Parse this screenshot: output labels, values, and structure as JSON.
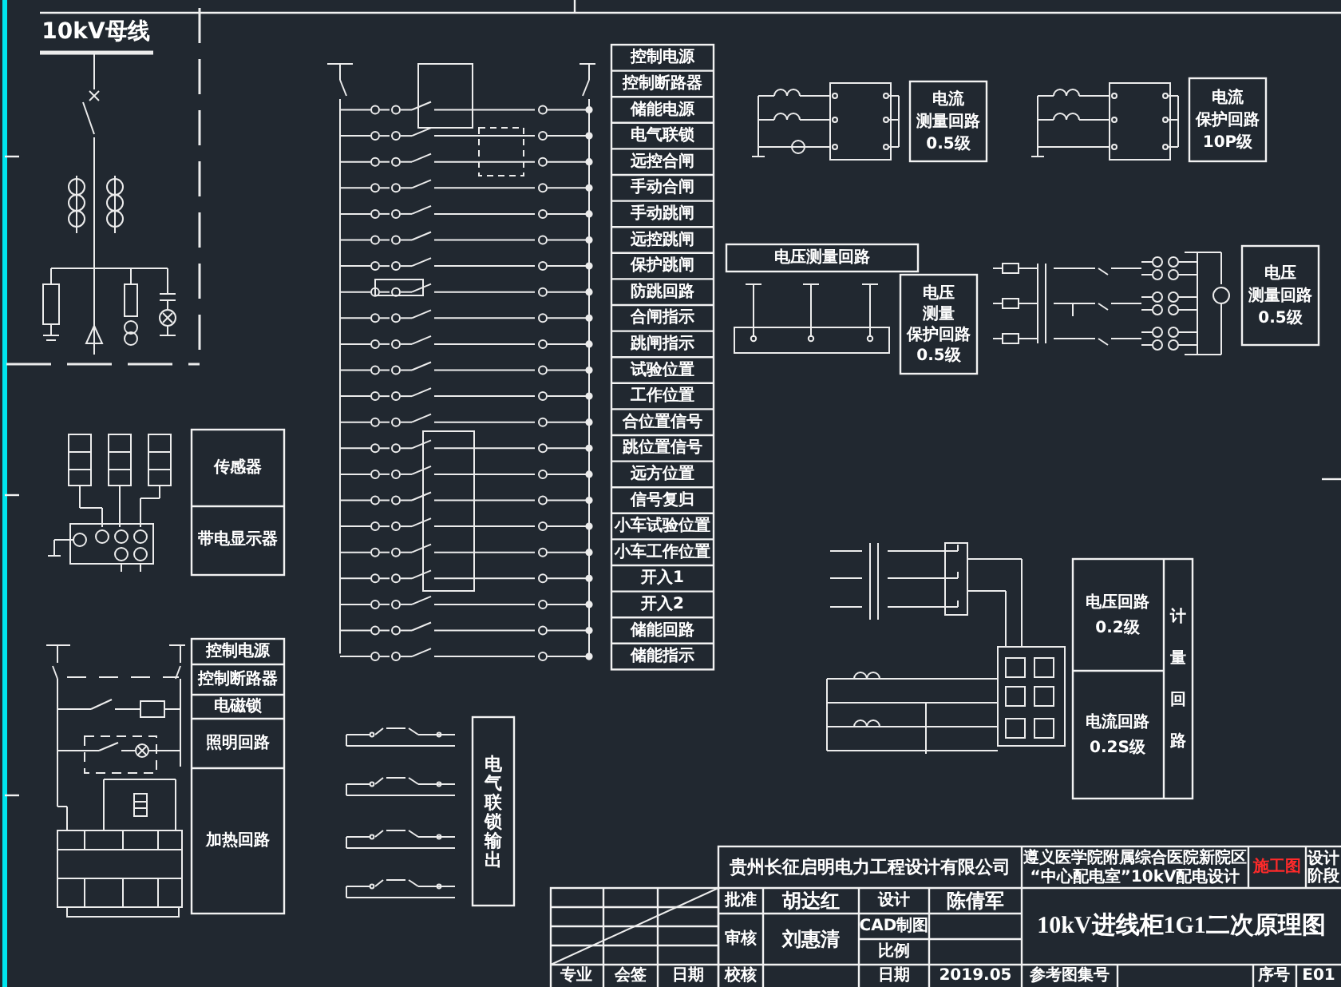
{
  "bus_label": "10kV母线",
  "sensor_labels": [
    "传感器",
    "带电显示器"
  ],
  "aux_labels": [
    "控制电源",
    "控制断路器",
    "电磁锁",
    "照明回路",
    "加热回路"
  ],
  "control_labels": [
    "控制电源",
    "控制断路器",
    "储能电源",
    "电气联锁",
    "远控合闸",
    "手动合闸",
    "手动跳闸",
    "远控跳闸",
    "保护跳闸",
    "防跳回路",
    "合闸指示",
    "跳闸指示",
    "试验位置",
    "工作位置",
    "合位置信号",
    "跳位置信号",
    "远方位置",
    "信号复归",
    "小车试验位置",
    "小车工作位置",
    "开入1",
    "开入2",
    "储能回路",
    "储能指示"
  ],
  "output_label": "电气联锁输出",
  "instrument_boxes": [
    {
      "lines": [
        "电流",
        "测量回路",
        "0.5级"
      ]
    },
    {
      "lines": [
        "电流",
        "保护回路",
        "10P级"
      ]
    },
    {
      "lines": [
        "电压",
        "测量",
        "保护回路",
        "0.5级"
      ]
    },
    {
      "lines": [
        "电压",
        "测量回路",
        "0.5级"
      ]
    }
  ],
  "voltage_bus_label": "电压测量回路",
  "metering": {
    "voltage": [
      "电压回路",
      "0.2级"
    ],
    "side": "计量回路",
    "current": [
      "电流回路",
      "0.2S级"
    ]
  },
  "title_block": {
    "company": "贵州长征启明电力工程设计有限公司",
    "project": [
      "遵义医学院附属综合医院新院区",
      "“中心配电室”10kV配电设计"
    ],
    "stage_mark": "施工图",
    "stage": [
      "设计",
      "阶段"
    ],
    "drawing_title": "10kV进线柜1G1二次原理图",
    "approve_label": "批准",
    "approve_sign": "胡达红",
    "design_label": "设计",
    "design_sign": "陈倩军",
    "review_label": "审核",
    "review_sign": "刘惠清",
    "cad_label": "CAD制图",
    "scale_label": "比例",
    "check_label": "校核",
    "date_label": "日期",
    "date": "2019.05",
    "atlas_label": "参考图集号",
    "serial_label": "序号",
    "serial": "E01",
    "countersign": [
      "专业",
      "会签",
      "日期"
    ]
  }
}
